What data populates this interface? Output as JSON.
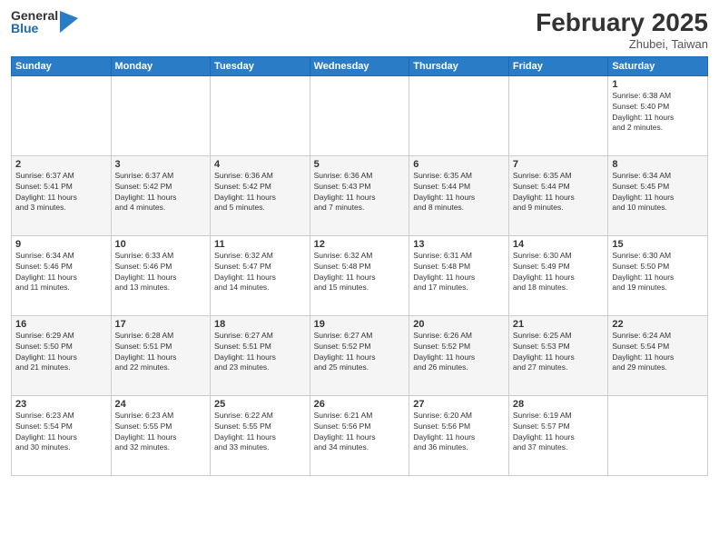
{
  "logo": {
    "general": "General",
    "blue": "Blue"
  },
  "title": "February 2025",
  "location": "Zhubei, Taiwan",
  "days_header": [
    "Sunday",
    "Monday",
    "Tuesday",
    "Wednesday",
    "Thursday",
    "Friday",
    "Saturday"
  ],
  "weeks": [
    [
      {
        "num": "",
        "info": ""
      },
      {
        "num": "",
        "info": ""
      },
      {
        "num": "",
        "info": ""
      },
      {
        "num": "",
        "info": ""
      },
      {
        "num": "",
        "info": ""
      },
      {
        "num": "",
        "info": ""
      },
      {
        "num": "1",
        "info": "Sunrise: 6:38 AM\nSunset: 5:40 PM\nDaylight: 11 hours\nand 2 minutes."
      }
    ],
    [
      {
        "num": "2",
        "info": "Sunrise: 6:37 AM\nSunset: 5:41 PM\nDaylight: 11 hours\nand 3 minutes."
      },
      {
        "num": "3",
        "info": "Sunrise: 6:37 AM\nSunset: 5:42 PM\nDaylight: 11 hours\nand 4 minutes."
      },
      {
        "num": "4",
        "info": "Sunrise: 6:36 AM\nSunset: 5:42 PM\nDaylight: 11 hours\nand 5 minutes."
      },
      {
        "num": "5",
        "info": "Sunrise: 6:36 AM\nSunset: 5:43 PM\nDaylight: 11 hours\nand 7 minutes."
      },
      {
        "num": "6",
        "info": "Sunrise: 6:35 AM\nSunset: 5:44 PM\nDaylight: 11 hours\nand 8 minutes."
      },
      {
        "num": "7",
        "info": "Sunrise: 6:35 AM\nSunset: 5:44 PM\nDaylight: 11 hours\nand 9 minutes."
      },
      {
        "num": "8",
        "info": "Sunrise: 6:34 AM\nSunset: 5:45 PM\nDaylight: 11 hours\nand 10 minutes."
      }
    ],
    [
      {
        "num": "9",
        "info": "Sunrise: 6:34 AM\nSunset: 5:46 PM\nDaylight: 11 hours\nand 11 minutes."
      },
      {
        "num": "10",
        "info": "Sunrise: 6:33 AM\nSunset: 5:46 PM\nDaylight: 11 hours\nand 13 minutes."
      },
      {
        "num": "11",
        "info": "Sunrise: 6:32 AM\nSunset: 5:47 PM\nDaylight: 11 hours\nand 14 minutes."
      },
      {
        "num": "12",
        "info": "Sunrise: 6:32 AM\nSunset: 5:48 PM\nDaylight: 11 hours\nand 15 minutes."
      },
      {
        "num": "13",
        "info": "Sunrise: 6:31 AM\nSunset: 5:48 PM\nDaylight: 11 hours\nand 17 minutes."
      },
      {
        "num": "14",
        "info": "Sunrise: 6:30 AM\nSunset: 5:49 PM\nDaylight: 11 hours\nand 18 minutes."
      },
      {
        "num": "15",
        "info": "Sunrise: 6:30 AM\nSunset: 5:50 PM\nDaylight: 11 hours\nand 19 minutes."
      }
    ],
    [
      {
        "num": "16",
        "info": "Sunrise: 6:29 AM\nSunset: 5:50 PM\nDaylight: 11 hours\nand 21 minutes."
      },
      {
        "num": "17",
        "info": "Sunrise: 6:28 AM\nSunset: 5:51 PM\nDaylight: 11 hours\nand 22 minutes."
      },
      {
        "num": "18",
        "info": "Sunrise: 6:27 AM\nSunset: 5:51 PM\nDaylight: 11 hours\nand 23 minutes."
      },
      {
        "num": "19",
        "info": "Sunrise: 6:27 AM\nSunset: 5:52 PM\nDaylight: 11 hours\nand 25 minutes."
      },
      {
        "num": "20",
        "info": "Sunrise: 6:26 AM\nSunset: 5:52 PM\nDaylight: 11 hours\nand 26 minutes."
      },
      {
        "num": "21",
        "info": "Sunrise: 6:25 AM\nSunset: 5:53 PM\nDaylight: 11 hours\nand 27 minutes."
      },
      {
        "num": "22",
        "info": "Sunrise: 6:24 AM\nSunset: 5:54 PM\nDaylight: 11 hours\nand 29 minutes."
      }
    ],
    [
      {
        "num": "23",
        "info": "Sunrise: 6:23 AM\nSunset: 5:54 PM\nDaylight: 11 hours\nand 30 minutes."
      },
      {
        "num": "24",
        "info": "Sunrise: 6:23 AM\nSunset: 5:55 PM\nDaylight: 11 hours\nand 32 minutes."
      },
      {
        "num": "25",
        "info": "Sunrise: 6:22 AM\nSunset: 5:55 PM\nDaylight: 11 hours\nand 33 minutes."
      },
      {
        "num": "26",
        "info": "Sunrise: 6:21 AM\nSunset: 5:56 PM\nDaylight: 11 hours\nand 34 minutes."
      },
      {
        "num": "27",
        "info": "Sunrise: 6:20 AM\nSunset: 5:56 PM\nDaylight: 11 hours\nand 36 minutes."
      },
      {
        "num": "28",
        "info": "Sunrise: 6:19 AM\nSunset: 5:57 PM\nDaylight: 11 hours\nand 37 minutes."
      },
      {
        "num": "",
        "info": ""
      }
    ]
  ]
}
